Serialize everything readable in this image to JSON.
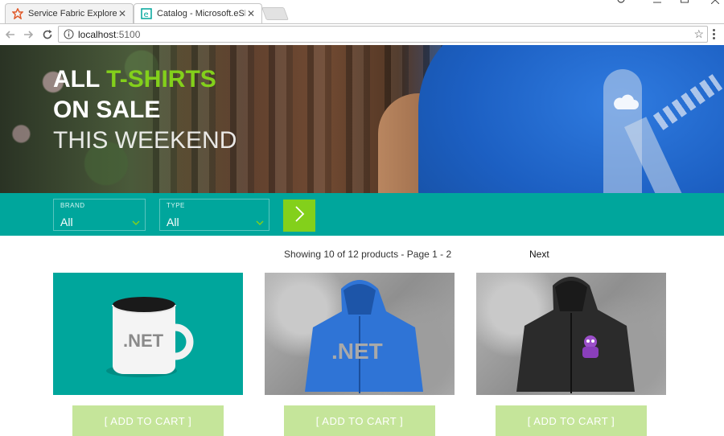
{
  "browser": {
    "tabs": [
      {
        "title": "Service Fabric Explorer",
        "active": false
      },
      {
        "title": "Catalog - Microsoft.eSho",
        "active": true
      }
    ],
    "url_host": "localhost",
    "url_port": ":5100"
  },
  "hero": {
    "line1_white": "ALL",
    "line1_green": "T-SHIRTS",
    "line2": "ON SALE",
    "line3": "THIS WEEKEND"
  },
  "filters": {
    "brand": {
      "label": "BRAND",
      "value": "All"
    },
    "type": {
      "label": "TYPE",
      "value": "All"
    }
  },
  "pager": {
    "info": "Showing 10 of 12 products - Page 1 - 2",
    "next": "Next"
  },
  "products": [
    {
      "image_text": ".NET",
      "button": "[ ADD TO CART ]"
    },
    {
      "image_text": ".NET",
      "button": "[ ADD TO CART ]"
    },
    {
      "image_text": "",
      "button": "[ ADD TO CART ]"
    }
  ],
  "colors": {
    "teal": "#00a69c",
    "green": "#83d01b",
    "button_light_green": "#c5e59a"
  }
}
